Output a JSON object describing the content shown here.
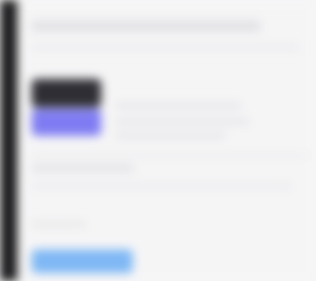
{
  "colors": {
    "sidebar": "#1c1c1e",
    "panel": "#f5f5f6",
    "dark_button": "#2e2e34",
    "accent_button": "#7f7cf3",
    "primary_button": "#7fb8f5"
  },
  "main": {
    "title": "",
    "subtitle": "",
    "dark_button_label": "",
    "accent_button_label": "",
    "section_label": "",
    "primary_button_label": ""
  }
}
